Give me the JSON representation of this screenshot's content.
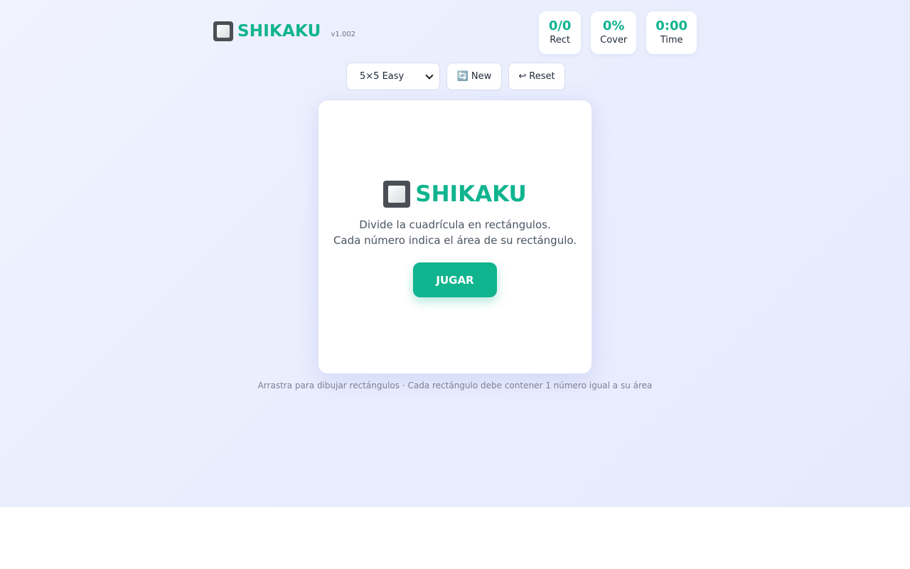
{
  "app": {
    "title": "SHIKAKU",
    "version": "v1.002",
    "icon": "square-button-icon",
    "accent_color": "#10b48f"
  },
  "stats": [
    {
      "value": "0/0",
      "label": "Rect"
    },
    {
      "value": "0%",
      "label": "Cover"
    },
    {
      "value": "0:00",
      "label": "Time"
    }
  ],
  "controls": {
    "difficulty_selected": "5×5 Easy",
    "new_icon": "🔄",
    "new_label": "New",
    "reset_icon": "↩",
    "reset_label": "Reset"
  },
  "overlay": {
    "title": "SHIKAKU",
    "line1": "Divide la cuadrícula en rectángulos.",
    "line2": "Cada número indica el área de su rectángulo.",
    "play_label": "JUGAR"
  },
  "hint": "Arrastra para dibujar rectángulos · Cada rectángulo debe contener 1 número igual a su área"
}
